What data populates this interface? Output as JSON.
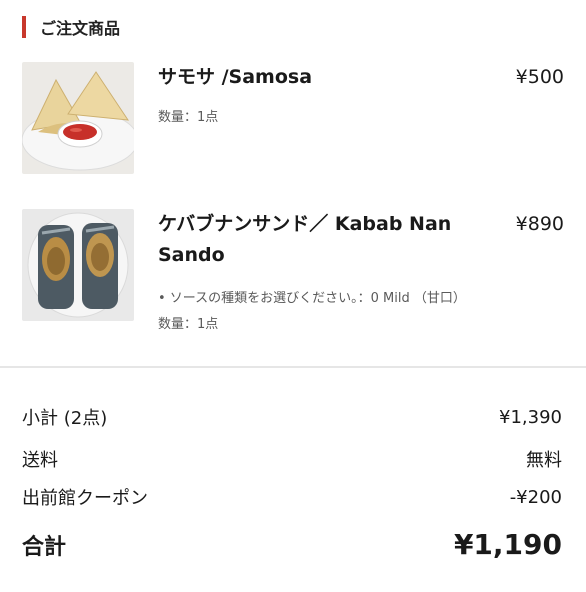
{
  "section": {
    "title": "ご注文商品"
  },
  "items": [
    {
      "name": "サモサ /Samosa",
      "price": "¥500",
      "quantity": "数量：1点",
      "image_icon": "samosa-photo"
    },
    {
      "name_line1": "ケバブナンサンド／ Kabab Nan",
      "name_line2": "Sando",
      "price": "¥890",
      "option": "• ソースの種類をお選びください。：0 Mild （甘口）",
      "quantity": "数量：1点",
      "image_icon": "kebab-wrap-photo"
    }
  ],
  "summary": {
    "subtotal_label": "小計 (2点)",
    "subtotal_value": "¥1,390",
    "shipping_label": "送料",
    "shipping_value": "無料",
    "coupon_label": "出前館クーポン",
    "coupon_value": "-¥200",
    "total_label": "合計",
    "total_value": "¥1,190"
  },
  "colors": {
    "accent": "#c8382c",
    "divider": "#e6e6e6"
  }
}
